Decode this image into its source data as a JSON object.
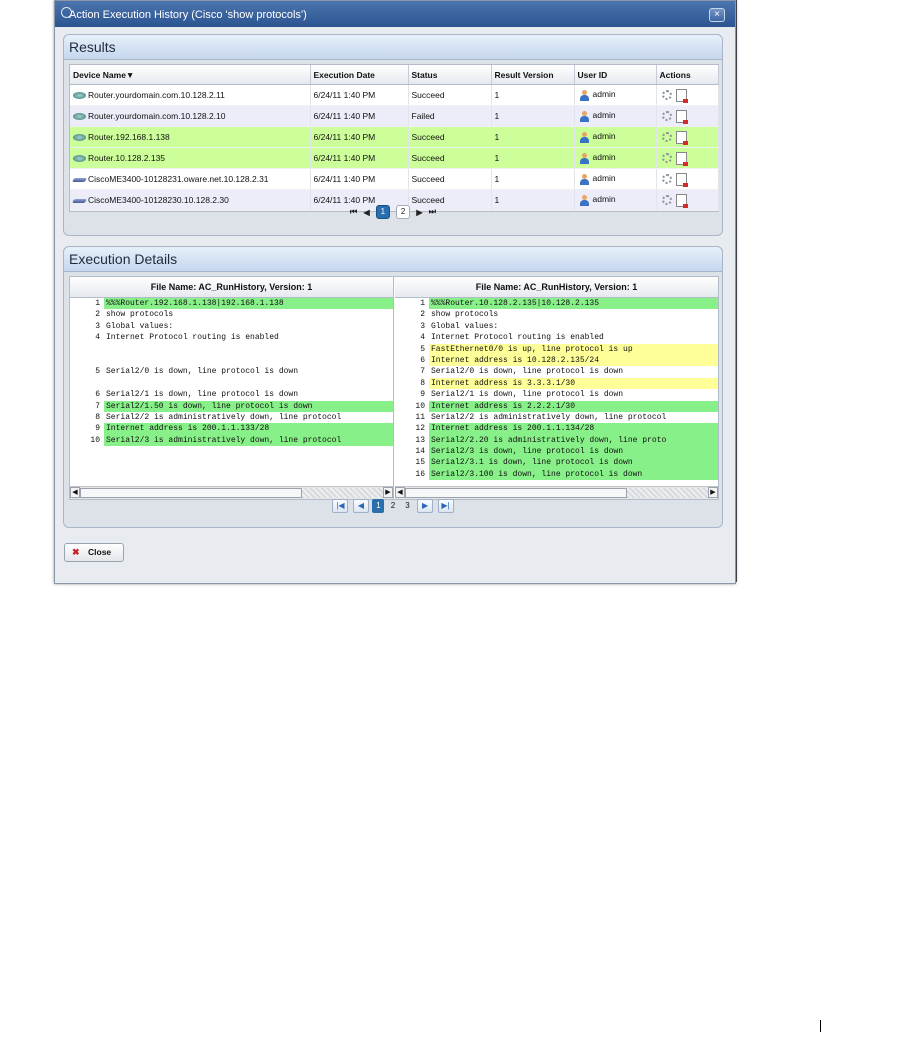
{
  "window": {
    "title": "Action Execution History (Cisco 'show protocols')",
    "close_glyph": "×"
  },
  "results": {
    "title": "Results",
    "columns": [
      "Device Name",
      "Execution Date",
      "Status",
      "Result Version",
      "User ID",
      "Actions"
    ],
    "sort_indicator": "▼",
    "rows": [
      {
        "device": "Router.yourdomain.com.10.128.2.11",
        "date": "6/24/11 1:40 PM",
        "status": "Succeed",
        "version": "1",
        "user": "admin",
        "icon": "router-icon",
        "highlight": "none"
      },
      {
        "device": "Router.yourdomain.com.10.128.2.10",
        "date": "6/24/11 1:40 PM",
        "status": "Failed",
        "version": "1",
        "user": "admin",
        "icon": "router-icon",
        "highlight": "alt"
      },
      {
        "device": "Router.192.168.1.138",
        "date": "6/24/11 1:40 PM",
        "status": "Succeed",
        "version": "1",
        "user": "admin",
        "icon": "router-icon",
        "highlight": "green"
      },
      {
        "device": "Router.10.128.2.135",
        "date": "6/24/11 1:40 PM",
        "status": "Succeed",
        "version": "1",
        "user": "admin",
        "icon": "router-icon",
        "highlight": "green"
      },
      {
        "device": "CiscoME3400-10128231.oware.net.10.128.2.31",
        "date": "6/24/11 1:40 PM",
        "status": "Succeed",
        "version": "1",
        "user": "admin",
        "icon": "switch-icon",
        "highlight": "none"
      },
      {
        "device": "CiscoME3400-10128230.10.128.2.30",
        "date": "6/24/11 1:40 PM",
        "status": "Succeed",
        "version": "1",
        "user": "admin",
        "icon": "switch-icon",
        "highlight": "alt"
      }
    ],
    "pager": {
      "pages": [
        "1",
        "2"
      ],
      "current": "1"
    }
  },
  "details": {
    "title": "Execution Details",
    "left": {
      "header": "File Name: AC_RunHistory, Version: 1",
      "lines": [
        {
          "n": "1",
          "t": "%%%Router.192.168.1.138|192.168.1.138",
          "h": "green"
        },
        {
          "n": "2",
          "t": "show protocols",
          "h": "none"
        },
        {
          "n": "3",
          "t": "Global values:",
          "h": "none"
        },
        {
          "n": "4",
          "t": "Internet Protocol routing is enabled",
          "h": "none"
        },
        {
          "n": "",
          "t": "",
          "h": "none"
        },
        {
          "n": "",
          "t": "",
          "h": "none"
        },
        {
          "n": "5",
          "t": "Serial2/0 is down, line protocol is down",
          "h": "none"
        },
        {
          "n": "",
          "t": "",
          "h": "none"
        },
        {
          "n": "6",
          "t": "Serial2/1 is down, line protocol is down",
          "h": "none"
        },
        {
          "n": "7",
          "t": "Serial2/1.50 is down, line protocol is down",
          "h": "green"
        },
        {
          "n": "8",
          "t": "Serial2/2 is administratively down, line protocol",
          "h": "none"
        },
        {
          "n": "9",
          "t": "Internet address is 200.1.1.133/28",
          "h": "green"
        },
        {
          "n": "10",
          "t": "Serial2/3 is administratively down, line protocol",
          "h": "green"
        }
      ]
    },
    "right": {
      "header": "File Name: AC_RunHistory, Version: 1",
      "lines": [
        {
          "n": "1",
          "t": "%%%Router.10.128.2.135|10.128.2.135",
          "h": "green"
        },
        {
          "n": "2",
          "t": "show protocols",
          "h": "none"
        },
        {
          "n": "3",
          "t": "Global values:",
          "h": "none"
        },
        {
          "n": "4",
          "t": "Internet Protocol routing is enabled",
          "h": "none"
        },
        {
          "n": "5",
          "t": "FastEthernet0/0 is up, line protocol is up",
          "h": "yellow"
        },
        {
          "n": "6",
          "t": "Internet address is 10.128.2.135/24",
          "h": "yellow"
        },
        {
          "n": "7",
          "t": "Serial2/0 is down, line protocol is down",
          "h": "none"
        },
        {
          "n": "8",
          "t": "Internet address is 3.3.3.1/30",
          "h": "yellow"
        },
        {
          "n": "9",
          "t": "Serial2/1 is down, line protocol is down",
          "h": "none"
        },
        {
          "n": "10",
          "t": "Internet address is 2.2.2.1/30",
          "h": "green"
        },
        {
          "n": "11",
          "t": "Serial2/2 is administratively down, line protocol",
          "h": "none"
        },
        {
          "n": "12",
          "t": "Internet address is 200.1.1.134/28",
          "h": "green"
        },
        {
          "n": "13",
          "t": "Serial2/2.20 is administratively down, line proto",
          "h": "green"
        },
        {
          "n": "14",
          "t": "Serial2/3 is down, line protocol is down",
          "h": "green"
        },
        {
          "n": "15",
          "t": "Serial2/3.1 is down, line protocol is down",
          "h": "green"
        },
        {
          "n": "16",
          "t": "Serial2/3.100 is down, line protocol is down",
          "h": "green"
        }
      ]
    },
    "pager": {
      "pages": [
        "1",
        "2",
        "3"
      ],
      "current": "1"
    }
  },
  "close_button": {
    "label": "Close"
  },
  "colors": {
    "title_bar": "#2c5491",
    "success_row": "#ccff99",
    "diff_added": "#88f088",
    "diff_changed": "#ffff99"
  }
}
